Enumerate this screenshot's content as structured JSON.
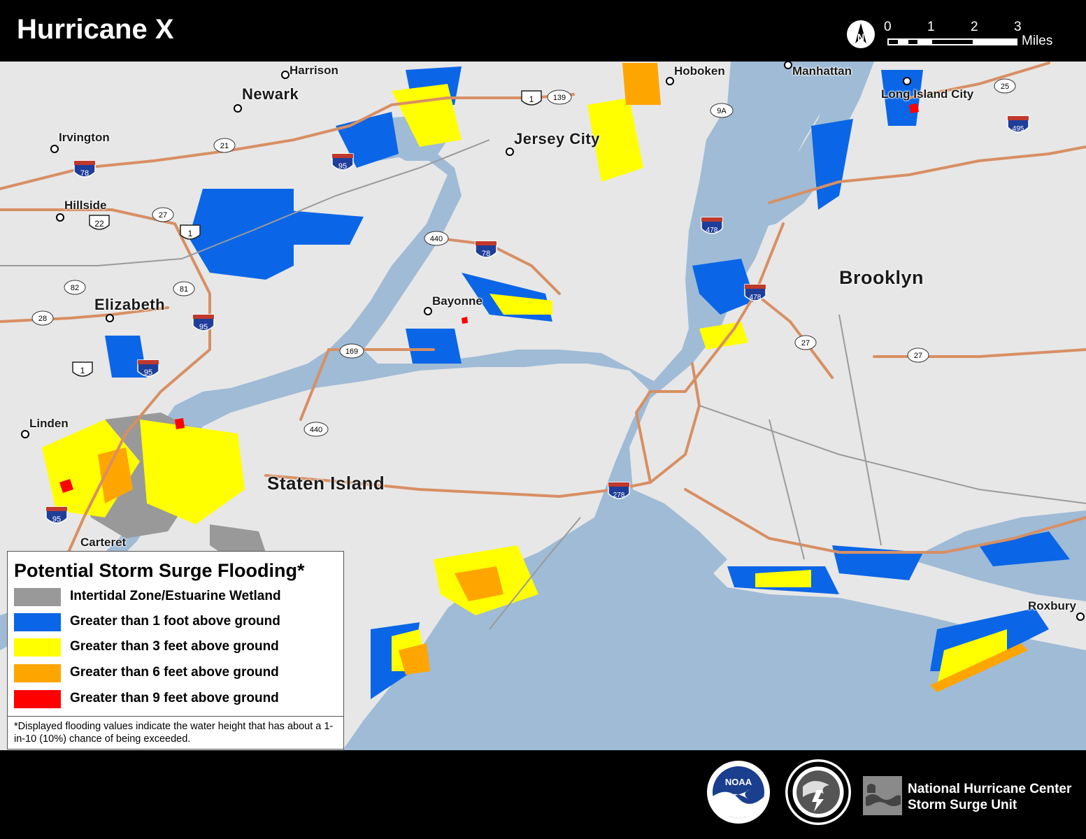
{
  "title": "Hurricane X",
  "scale": {
    "ticks": [
      "0",
      "1",
      "2",
      "3"
    ],
    "unit": "Miles"
  },
  "north_arrow": {
    "label": "N",
    "icon": "north-arrow-icon"
  },
  "colors": {
    "water": "#9fbbd6",
    "land": "#e7e7e7",
    "road": "#d88f63",
    "wetland": "#999999",
    "surge_1ft": "#0a66e6",
    "surge_3ft": "#ffff00",
    "surge_6ft": "#ffa500",
    "surge_9ft": "#ff0000"
  },
  "places": {
    "harrison": "Harrison",
    "newark": "Newark",
    "irvington": "Irvington",
    "hillside": "Hillside",
    "elizabeth": "Elizabeth",
    "linden": "Linden",
    "carteret": "Carteret",
    "hoboken": "Hoboken",
    "manhattan": "Manhattan",
    "long_island_city": "Long Island City",
    "jersey_city": "Jersey City",
    "bayonne": "Bayonne",
    "brooklyn": "Brooklyn",
    "staten_island": "Staten Island",
    "roxbury": "Roxbury"
  },
  "route_shields": {
    "interstate": [
      "78",
      "95",
      "95",
      "95",
      "95",
      "78",
      "478",
      "478",
      "278",
      "495"
    ],
    "us": [
      "1",
      "1",
      "1",
      "22"
    ],
    "state": [
      "21",
      "27",
      "82",
      "81",
      "28",
      "169",
      "440",
      "440",
      "139",
      "9A",
      "25",
      "27",
      "27"
    ]
  },
  "legend": {
    "title": "Potential Storm Surge Flooding*",
    "items": [
      {
        "label": "Intertidal Zone/Estuarine Wetland",
        "color": "#999999"
      },
      {
        "label": "Greater than 1 foot above ground",
        "color": "#0a66e6"
      },
      {
        "label": "Greater than 3 feet above ground",
        "color": "#ffff00"
      },
      {
        "label": "Greater than 6 feet above ground",
        "color": "#ffa500"
      },
      {
        "label": "Greater than 9 feet above ground",
        "color": "#ff0000"
      }
    ],
    "note": "*Displayed flooding values indicate the water height that has about a 1-in-10 (10%) chance of being exceeded."
  },
  "footer": {
    "logos": [
      "noaa-logo",
      "national-weather-service-logo",
      "nhc-logo"
    ],
    "noaa_text": "NOAA",
    "nhc_line1": "National Hurricane Center",
    "nhc_line2": "Storm Surge Unit"
  }
}
